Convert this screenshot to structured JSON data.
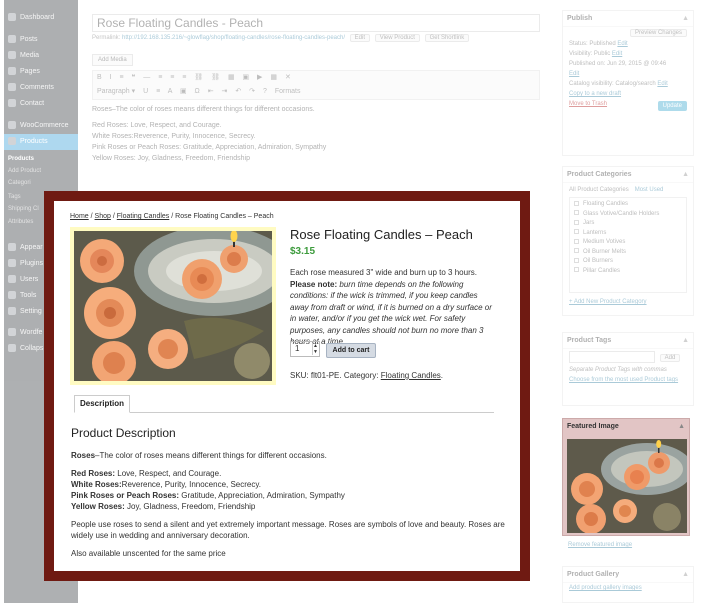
{
  "admin": {
    "menu": [
      {
        "label": "Dashboard",
        "icon": "dashboard-icon"
      },
      {
        "label": "Posts",
        "icon": "pin-icon"
      },
      {
        "label": "Media",
        "icon": "media-icon"
      },
      {
        "label": "Pages",
        "icon": "page-icon"
      },
      {
        "label": "Comments",
        "icon": "comment-icon"
      },
      {
        "label": "Contact",
        "icon": "mail-icon"
      },
      {
        "label": "WooCommerce",
        "icon": "woocommerce-icon"
      },
      {
        "label": "Products",
        "icon": "cart-icon"
      },
      {
        "label": "Appear",
        "icon": "brush-icon"
      },
      {
        "label": "Plugins",
        "icon": "plugin-icon"
      },
      {
        "label": "Users",
        "icon": "user-icon"
      },
      {
        "label": "Tools",
        "icon": "wrench-icon"
      },
      {
        "label": "Setting",
        "icon": "settings-icon"
      },
      {
        "label": "Wordfe",
        "icon": "shield-icon"
      },
      {
        "label": "Collaps",
        "icon": "collapse-icon"
      }
    ],
    "products_submenu": [
      "Products",
      "Add Product",
      "Categori",
      "Tags",
      "Shipping Cl",
      "Attributes"
    ],
    "editor": {
      "title": "Rose Floating Candles - Peach",
      "permalink_label": "Permalink:",
      "permalink_url": "http://192.168.135.216/~glowflag/shop/floating-candles/rose-floating-candles-peach/",
      "edit": "Edit",
      "view_product": "View Product",
      "get_shortlink": "Get Shortlink",
      "add_media": "Add Media",
      "paragraph": "Paragraph",
      "formats": "Formats",
      "content": [
        "Roses–The color of roses means different things for different occasions.",
        "Red Roses: Love, Respect, and Courage.",
        "White Roses:Reverence, Purity, Innocence, Secrecy.",
        "Pink Roses or Peach Roses: Gratitude, Appreciation, Admiration, Sympathy",
        "Yellow Roses: Joy, Gladness, Freedom, Friendship"
      ]
    },
    "publish": {
      "title": "Publish",
      "preview_changes": "Preview Changes",
      "status": "Status: Published",
      "visibility": "Visibility: Public",
      "published_on": "Published on: Jun 29, 2015 @ 09:46",
      "edit": "Edit",
      "catalog_visibility": "Catalog visibility: Catalog/search",
      "copy_draft": "Copy to a new draft",
      "move_trash": "Move to Trash",
      "update": "Update"
    },
    "categories": {
      "title": "Product Categories",
      "tab_all": "All Product Categories",
      "tab_used": "Most Used",
      "items": [
        "Floating Candles",
        "Glass Votive/Candle Holders",
        "Jars",
        "Lanterns",
        "Medium Votives",
        "Oil Burner Melts",
        "Oil Burners",
        "Pillar Candles"
      ],
      "add_new": "+ Add New Product Category"
    },
    "tags": {
      "title": "Product Tags",
      "add": "Add",
      "hint": "Separate Product Tags with commas",
      "choose": "Choose from the most used Product tags"
    },
    "featured_image": {
      "title": "Featured Image",
      "remove": "Remove featured image"
    },
    "gallery": {
      "title": "Product Gallery",
      "add": "Add product gallery images"
    }
  },
  "product": {
    "breadcrumb": {
      "home": "Home",
      "sep": "/",
      "shop": "Shop",
      "category": "Floating Candles",
      "current": "Rose Floating Candles – Peach"
    },
    "title": "Rose Floating Candles – Peach",
    "price": "$3.15",
    "desc_intro": "Each rose measured 3\" wide and burn up to 3 hours.",
    "desc_note_label": "Please note:",
    "desc_note": "burn time depends on the following conditions: if the wick is trimmed, if you keep candles away from draft or wind, if it is burned on a dry surface or in water, and/or if you get the wick wet. For safety purposes, any candles should not burn no more than 3 hours at a time.",
    "quantity": "1",
    "add_to_cart": "Add to cart",
    "sku_label": "SKU:",
    "sku": "flt01-PE.",
    "category_label": "Category:",
    "category": "Floating Candles",
    "tab_description": "Description",
    "section_title": "Product Description",
    "roses_label": "Roses",
    "roses_text": "–The color of roses means different things for different occasions.",
    "red_label": "Red Roses:",
    "red_text": " Love, Respect, and Courage.",
    "white_label": "White Roses:",
    "white_text": "Reverence, Purity, Innocence, Secrecy.",
    "pink_label": "Pink Roses or Peach Roses:",
    "pink_text": " Gratitude, Appreciation, Admiration, Sympathy",
    "yellow_label": "Yellow Roses:",
    "yellow_text": " Joy, Gladness, Freedom, Friendship",
    "usage": "People use roses to send a silent and yet extremely important message. Roses are symbols of love and beauty. Roses are widely use in wedding and anniversary decoration.",
    "unscented": "Also available unscented for the same price"
  },
  "colors": {
    "frame": "#6f1a12",
    "price": "#3c9b3c",
    "admin_sidebar": "#2a2f35",
    "admin_accent": "#2e9bd6",
    "featured_box": "#e2c5c5"
  }
}
